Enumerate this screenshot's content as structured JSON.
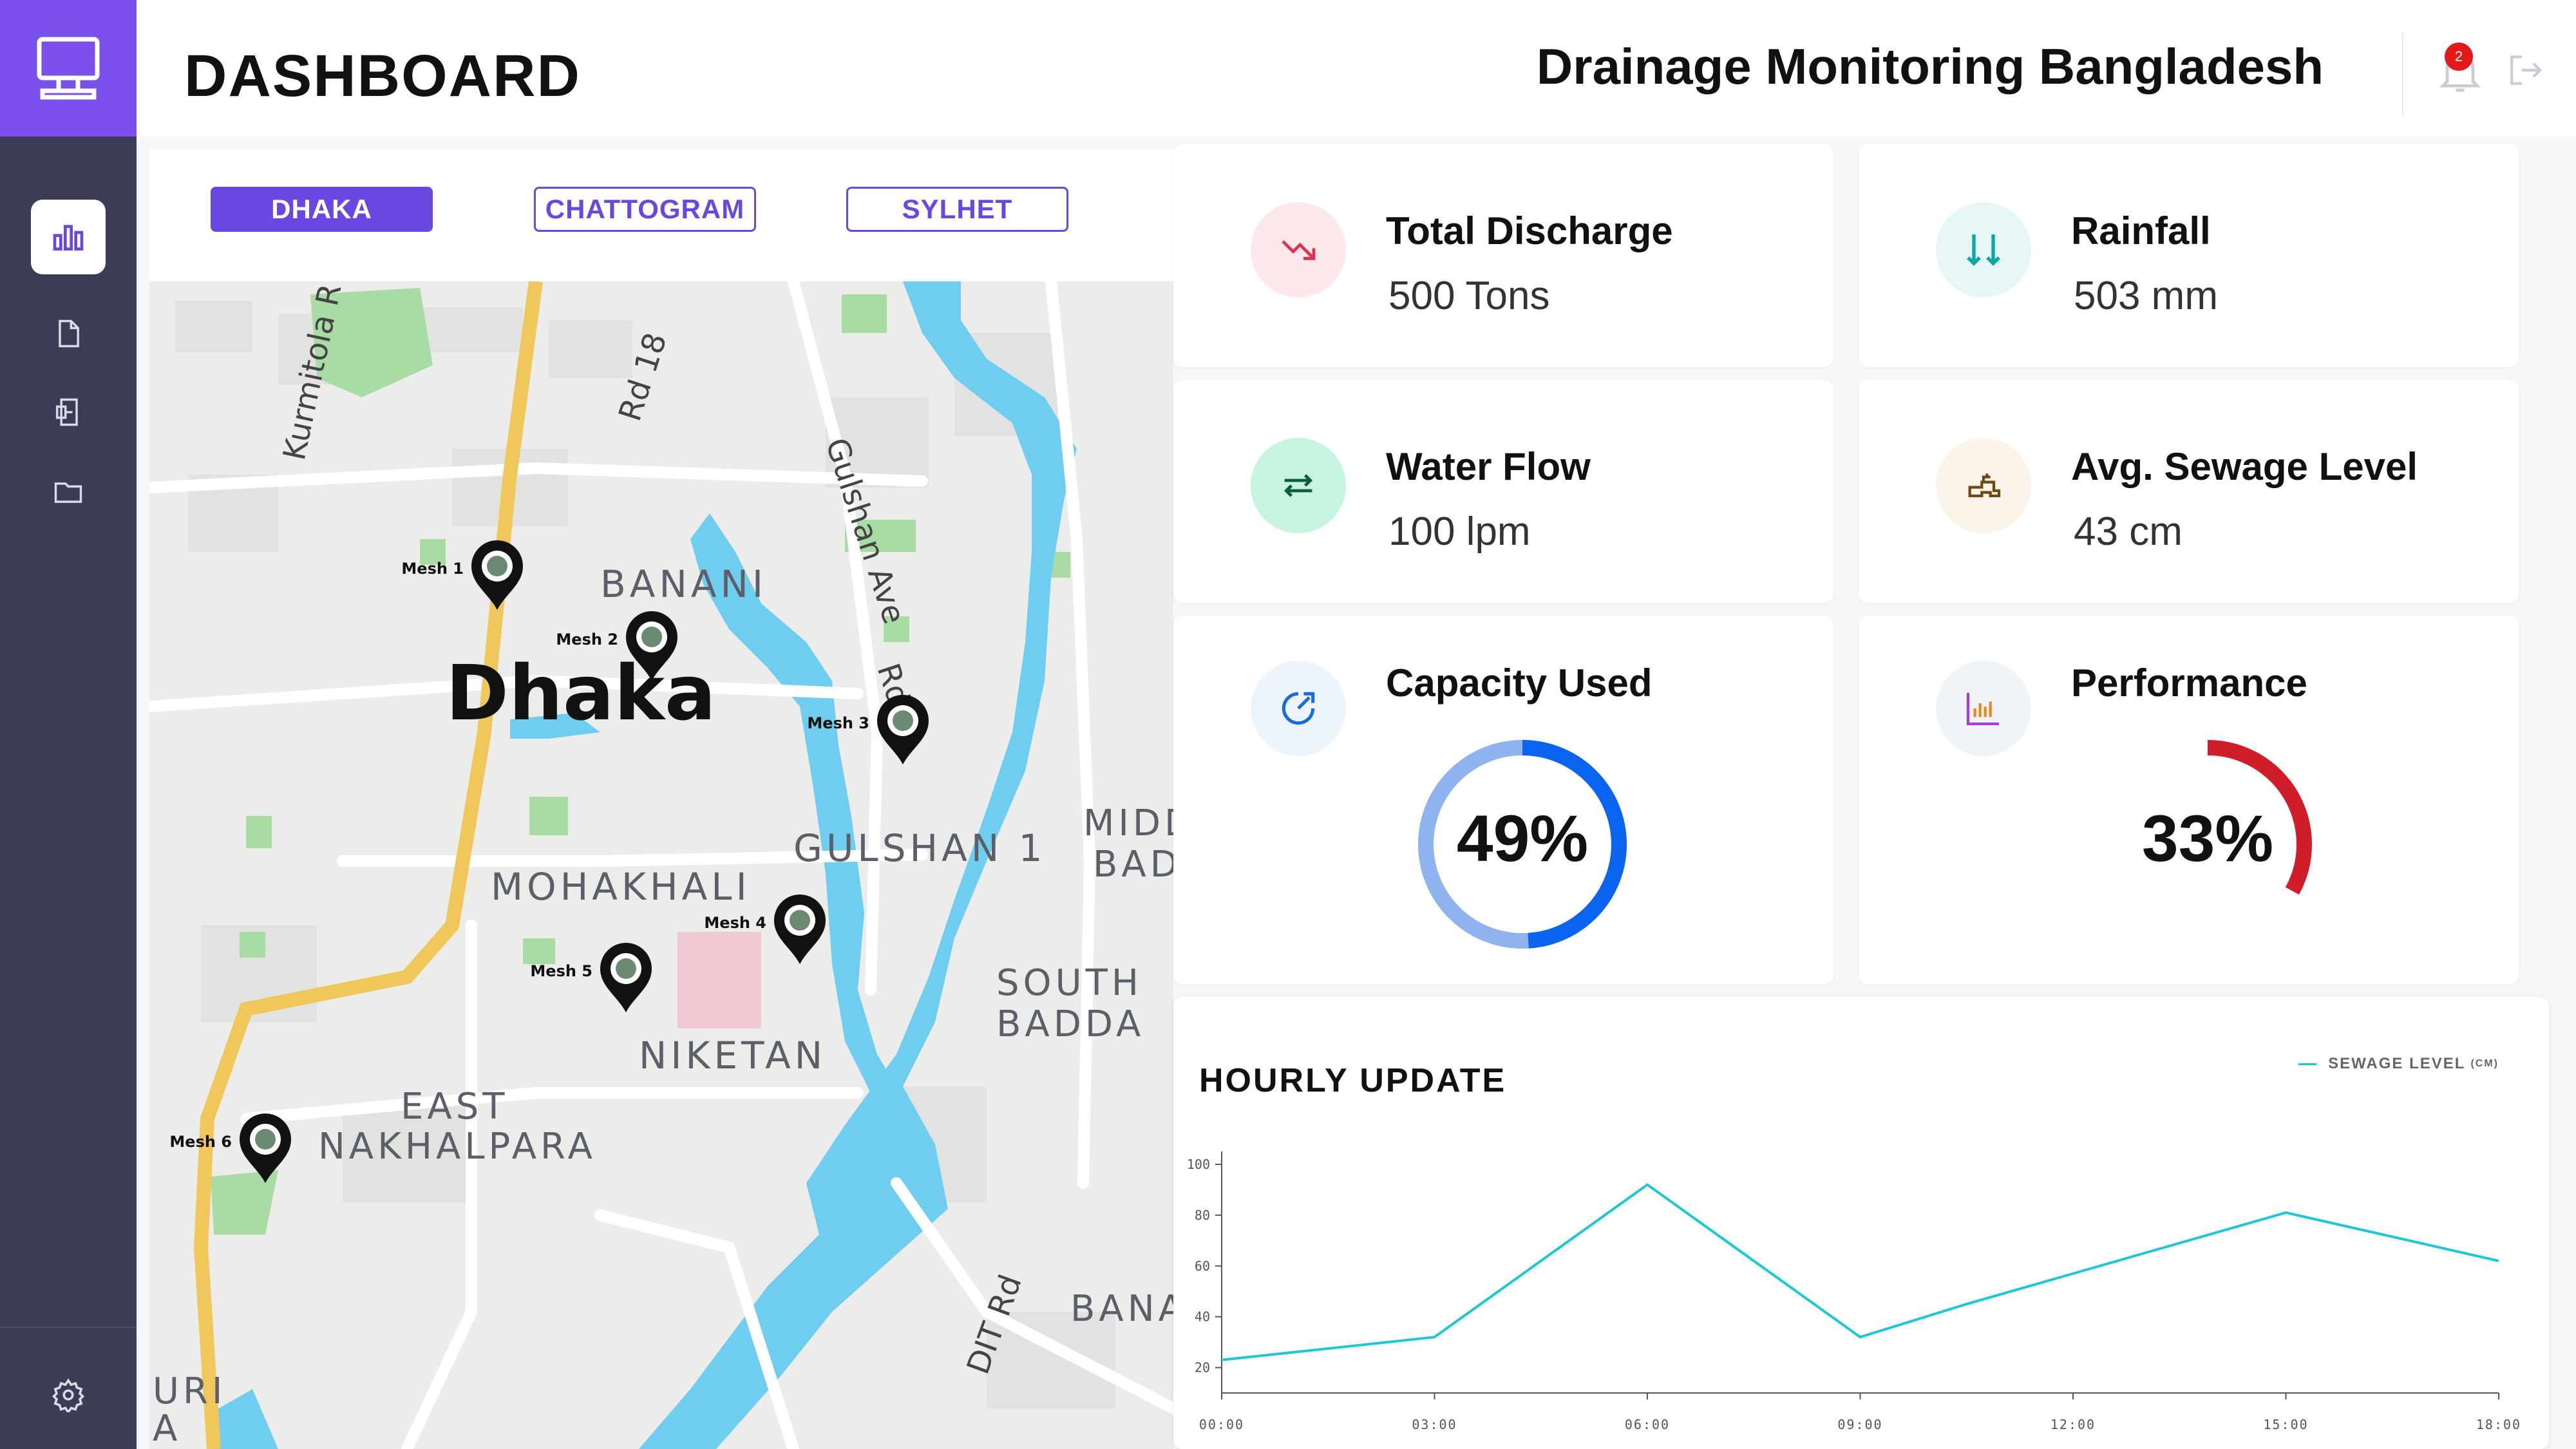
{
  "header": {
    "page_title": "DASHBOARD",
    "brand": "Drainage Monitoring Bangladesh",
    "notification_count": "2"
  },
  "sidebar": {
    "items": [
      {
        "name": "analytics-icon",
        "active": true
      },
      {
        "name": "document-icon",
        "active": false
      },
      {
        "name": "report-icon",
        "active": false
      },
      {
        "name": "folder-icon",
        "active": false
      }
    ],
    "footer": "settings-icon"
  },
  "cities": {
    "tabs": [
      "DHAKA",
      "CHATTOGRAM",
      "SYLHET"
    ],
    "selected": "DHAKA"
  },
  "map": {
    "city_label": "Dhaka",
    "areas": [
      "BANANI",
      "GULSHAN 1",
      "MOHAKHALI",
      "NIKETAN",
      "EAST",
      "NAKHALPARA",
      "SOUTH",
      "BADDA",
      "MIDD",
      "BAD",
      "BANA",
      "URI",
      "A"
    ],
    "roads": [
      "Kurmitola R",
      "Rd 18",
      "Gulshan Ave",
      "Rd 2",
      "DIT Rd"
    ],
    "markers": [
      "Mesh 1",
      "Mesh 2",
      "Mesh 3",
      "Mesh 4",
      "Mesh 5",
      "Mesh 6"
    ]
  },
  "stats": {
    "discharge": {
      "title": "Total Discharge",
      "value": "500 Tons",
      "icon": "trend-down-icon"
    },
    "rainfall": {
      "title": "Rainfall",
      "value": "503 mm",
      "icon": "rain-arrows-icon"
    },
    "flow": {
      "title": "Water Flow",
      "value": "100 lpm",
      "icon": "flow-arrows-icon"
    },
    "sewage": {
      "title": "Avg. Sewage Level",
      "value": "43 cm",
      "icon": "faucet-icon"
    },
    "capacity": {
      "title": "Capacity Used",
      "value": "49%",
      "fraction": 0.49,
      "icon": "gauge-icon",
      "color": "#0a64f0"
    },
    "performance": {
      "title": "Performance",
      "value": "33%",
      "fraction": 0.33,
      "icon": "bar-chart-icon",
      "color": "#cf1d2a"
    }
  },
  "chart": {
    "title": "HOURLY UPDATE",
    "legend": "SEWAGE LEVEL",
    "legend_unit": "(CM)"
  },
  "chart_data": {
    "type": "line",
    "x": [
      "00:00",
      "03:00",
      "06:00",
      "09:00",
      "12:00",
      "15:00",
      "18:00"
    ],
    "x_all": [
      0,
      3,
      6,
      9,
      12,
      15,
      18
    ],
    "series": [
      {
        "name": "SEWAGE LEVEL (CM)",
        "color": "#1cc8d6",
        "x": [
          0,
          3,
          6,
          9,
          10.5,
          12,
          15,
          18
        ],
        "values": [
          23,
          32,
          92,
          32,
          45,
          57,
          81,
          62
        ]
      }
    ],
    "yticks": [
      20,
      40,
      60,
      80,
      100
    ],
    "ylim": [
      10,
      100
    ],
    "xlim": [
      0,
      18
    ]
  }
}
